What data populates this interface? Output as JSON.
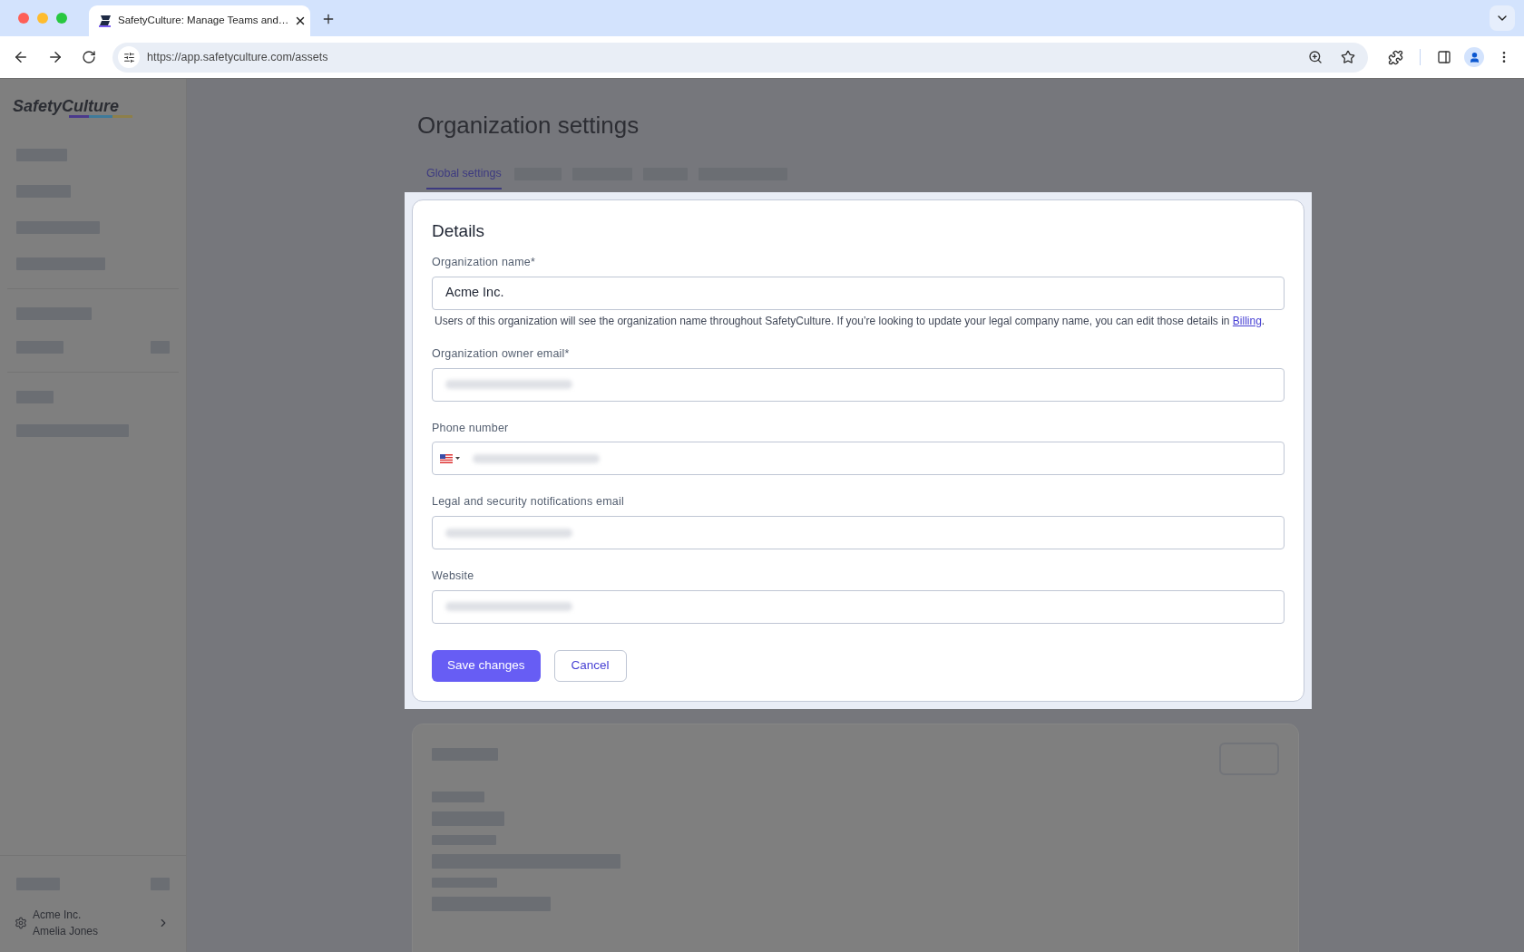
{
  "browser": {
    "tab_title": "SafetyCulture: Manage Teams and…",
    "url": "https://app.safetyculture.com/assets"
  },
  "sidebar": {
    "logo": "SafetyCulture",
    "footer": {
      "organization": "Acme Inc.",
      "user": "Amelia Jones"
    }
  },
  "page": {
    "title": "Organization settings",
    "tabs": [
      {
        "label": "Global settings",
        "selected": true
      }
    ]
  },
  "details": {
    "title": "Details",
    "fields": [
      {
        "kind": "text",
        "label": "Organization name*",
        "value": "Acme Inc.",
        "help": "Users of this organization will see the organization name throughout SafetyCulture. If you’re looking to update your legal company name, you can edit those details in ",
        "help_link": "Billing",
        "help_end": "."
      },
      {
        "kind": "text",
        "label": "Organization owner email*",
        "redacted": true
      },
      {
        "kind": "phone",
        "label": "Phone number",
        "redacted": true
      },
      {
        "kind": "text",
        "label": "Legal and security notifications email",
        "redacted": true
      },
      {
        "kind": "text",
        "label": "Website",
        "redacted": true
      }
    ],
    "buttons": [
      {
        "kind": "primary",
        "label": "Save changes"
      },
      {
        "kind": "secondary",
        "label": "Cancel"
      }
    ]
  }
}
